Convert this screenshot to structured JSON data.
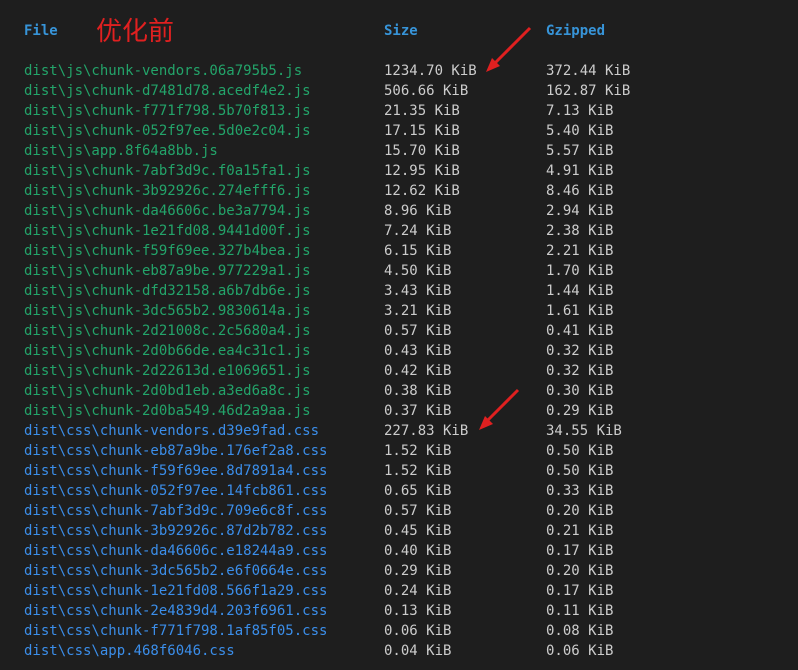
{
  "header": {
    "file_label": "File",
    "size_label": "Size",
    "gzipped_label": "Gzipped",
    "annotation": "优化前"
  },
  "rows": [
    {
      "kind": "js",
      "file": "dist\\js\\chunk-vendors.06a795b5.js",
      "size": "1234.70 KiB",
      "gzipped": "372.44 KiB"
    },
    {
      "kind": "js",
      "file": "dist\\js\\chunk-d7481d78.acedf4e2.js",
      "size": "506.66 KiB",
      "gzipped": "162.87 KiB"
    },
    {
      "kind": "js",
      "file": "dist\\js\\chunk-f771f798.5b70f813.js",
      "size": "21.35 KiB",
      "gzipped": "7.13 KiB"
    },
    {
      "kind": "js",
      "file": "dist\\js\\chunk-052f97ee.5d0e2c04.js",
      "size": "17.15 KiB",
      "gzipped": "5.40 KiB"
    },
    {
      "kind": "js",
      "file": "dist\\js\\app.8f64a8bb.js",
      "size": "15.70 KiB",
      "gzipped": "5.57 KiB"
    },
    {
      "kind": "js",
      "file": "dist\\js\\chunk-7abf3d9c.f0a15fa1.js",
      "size": "12.95 KiB",
      "gzipped": "4.91 KiB"
    },
    {
      "kind": "js",
      "file": "dist\\js\\chunk-3b92926c.274efff6.js",
      "size": "12.62 KiB",
      "gzipped": "8.46 KiB"
    },
    {
      "kind": "js",
      "file": "dist\\js\\chunk-da46606c.be3a7794.js",
      "size": "8.96 KiB",
      "gzipped": "2.94 KiB"
    },
    {
      "kind": "js",
      "file": "dist\\js\\chunk-1e21fd08.9441d00f.js",
      "size": "7.24 KiB",
      "gzipped": "2.38 KiB"
    },
    {
      "kind": "js",
      "file": "dist\\js\\chunk-f59f69ee.327b4bea.js",
      "size": "6.15 KiB",
      "gzipped": "2.21 KiB"
    },
    {
      "kind": "js",
      "file": "dist\\js\\chunk-eb87a9be.977229a1.js",
      "size": "4.50 KiB",
      "gzipped": "1.70 KiB"
    },
    {
      "kind": "js",
      "file": "dist\\js\\chunk-dfd32158.a6b7db6e.js",
      "size": "3.43 KiB",
      "gzipped": "1.44 KiB"
    },
    {
      "kind": "js",
      "file": "dist\\js\\chunk-3dc565b2.9830614a.js",
      "size": "3.21 KiB",
      "gzipped": "1.61 KiB"
    },
    {
      "kind": "js",
      "file": "dist\\js\\chunk-2d21008c.2c5680a4.js",
      "size": "0.57 KiB",
      "gzipped": "0.41 KiB"
    },
    {
      "kind": "js",
      "file": "dist\\js\\chunk-2d0b66de.ea4c31c1.js",
      "size": "0.43 KiB",
      "gzipped": "0.32 KiB"
    },
    {
      "kind": "js",
      "file": "dist\\js\\chunk-2d22613d.e1069651.js",
      "size": "0.42 KiB",
      "gzipped": "0.32 KiB"
    },
    {
      "kind": "js",
      "file": "dist\\js\\chunk-2d0bd1eb.a3ed6a8c.js",
      "size": "0.38 KiB",
      "gzipped": "0.30 KiB"
    },
    {
      "kind": "js",
      "file": "dist\\js\\chunk-2d0ba549.46d2a9aa.js",
      "size": "0.37 KiB",
      "gzipped": "0.29 KiB"
    },
    {
      "kind": "css",
      "file": "dist\\css\\chunk-vendors.d39e9fad.css",
      "size": "227.83 KiB",
      "gzipped": "34.55 KiB"
    },
    {
      "kind": "css",
      "file": "dist\\css\\chunk-eb87a9be.176ef2a8.css",
      "size": "1.52 KiB",
      "gzipped": "0.50 KiB"
    },
    {
      "kind": "css",
      "file": "dist\\css\\chunk-f59f69ee.8d7891a4.css",
      "size": "1.52 KiB",
      "gzipped": "0.50 KiB"
    },
    {
      "kind": "css",
      "file": "dist\\css\\chunk-052f97ee.14fcb861.css",
      "size": "0.65 KiB",
      "gzipped": "0.33 KiB"
    },
    {
      "kind": "css",
      "file": "dist\\css\\chunk-7abf3d9c.709e6c8f.css",
      "size": "0.57 KiB",
      "gzipped": "0.20 KiB"
    },
    {
      "kind": "css",
      "file": "dist\\css\\chunk-3b92926c.87d2b782.css",
      "size": "0.45 KiB",
      "gzipped": "0.21 KiB"
    },
    {
      "kind": "css",
      "file": "dist\\css\\chunk-da46606c.e18244a9.css",
      "size": "0.40 KiB",
      "gzipped": "0.17 KiB"
    },
    {
      "kind": "css",
      "file": "dist\\css\\chunk-3dc565b2.e6f0664e.css",
      "size": "0.29 KiB",
      "gzipped": "0.20 KiB"
    },
    {
      "kind": "css",
      "file": "dist\\css\\chunk-1e21fd08.566f1a29.css",
      "size": "0.24 KiB",
      "gzipped": "0.17 KiB"
    },
    {
      "kind": "css",
      "file": "dist\\css\\chunk-2e4839d4.203f6961.css",
      "size": "0.13 KiB",
      "gzipped": "0.11 KiB"
    },
    {
      "kind": "css",
      "file": "dist\\css\\chunk-f771f798.1af85f05.css",
      "size": "0.06 KiB",
      "gzipped": "0.08 KiB"
    },
    {
      "kind": "css",
      "file": "dist\\css\\app.468f6046.css",
      "size": "0.04 KiB",
      "gzipped": "0.06 KiB"
    }
  ],
  "colors": {
    "background": "#1e1e1e",
    "header": "#3794d8",
    "js_file": "#23a46a",
    "css_file": "#3b8eea",
    "value": "#cccccc",
    "annotation": "#e02020"
  },
  "icons": [
    "red-arrow-icon",
    "red-arrow-icon"
  ]
}
